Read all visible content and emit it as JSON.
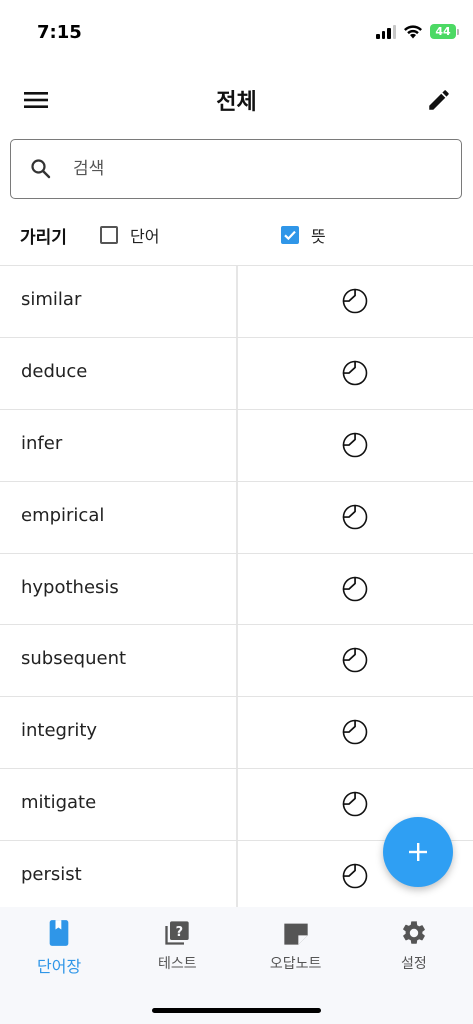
{
  "status_bar": {
    "time": "7:15",
    "battery": "44"
  },
  "app_bar": {
    "title": "전체",
    "menu_icon": "hamburger-menu-icon",
    "edit_icon": "pencil-icon"
  },
  "search": {
    "placeholder": "검색",
    "value": ""
  },
  "filter": {
    "label": "가리기",
    "word_option": {
      "label": "단어",
      "checked": false
    },
    "meaning_option": {
      "label": "뜻",
      "checked": true
    }
  },
  "words": [
    {
      "word": "similar"
    },
    {
      "word": "deduce"
    },
    {
      "word": "infer"
    },
    {
      "word": "empirical"
    },
    {
      "word": "hypothesis"
    },
    {
      "word": "subsequent"
    },
    {
      "word": "integrity"
    },
    {
      "word": "mitigate"
    },
    {
      "word": "persist"
    }
  ],
  "fab": {
    "icon": "plus-icon"
  },
  "bottom_nav": {
    "items": [
      {
        "label": "단어장",
        "icon": "book-icon",
        "active": true
      },
      {
        "label": "테스트",
        "icon": "quiz-icon",
        "active": false
      },
      {
        "label": "오답노트",
        "icon": "note-icon",
        "active": false
      },
      {
        "label": "설정",
        "icon": "gear-icon",
        "active": false
      }
    ]
  },
  "colors": {
    "accent": "#2f96e8",
    "fab": "#2f9ff3",
    "battery": "#4cd964"
  }
}
